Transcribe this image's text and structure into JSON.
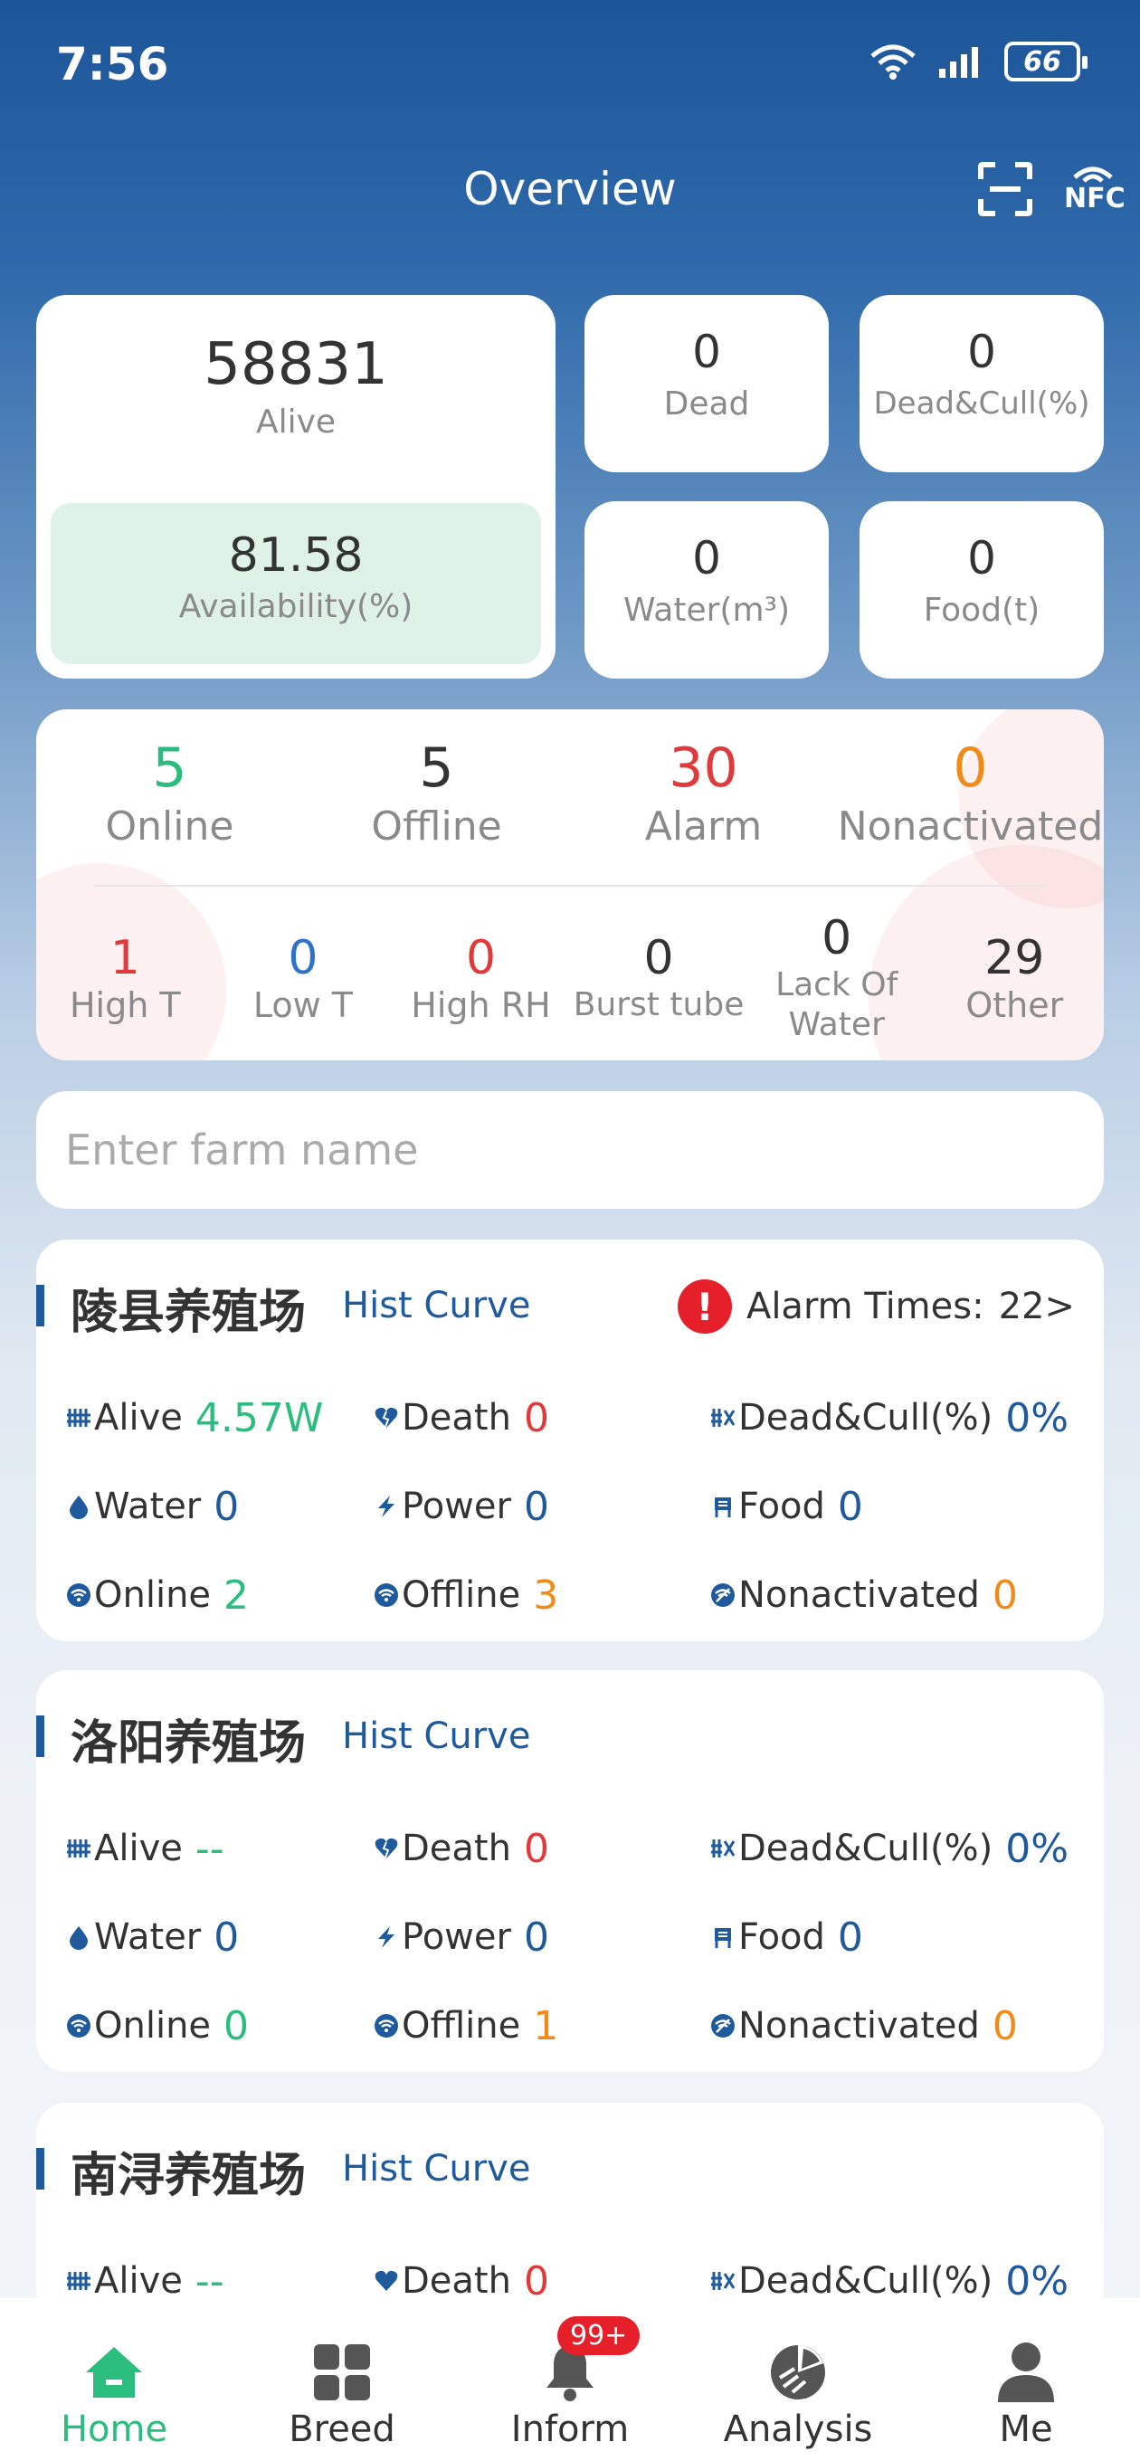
{
  "status_bar": {
    "time": "7:56",
    "battery": "66"
  },
  "header": {
    "title": "Overview",
    "nfc_label": "NFC"
  },
  "overview": {
    "alive": {
      "value": "58831",
      "label": "Alive"
    },
    "availability": {
      "value": "81.58",
      "label": "Availability(%)"
    },
    "dead": {
      "value": "0",
      "label": "Dead"
    },
    "dead_cull": {
      "value": "0",
      "label": "Dead&Cull(%)"
    },
    "water": {
      "value": "0",
      "label": "Water(m³)"
    },
    "food": {
      "value": "0",
      "label": "Food(t)"
    }
  },
  "devices": {
    "online": {
      "value": "5",
      "label": "Online"
    },
    "offline": {
      "value": "5",
      "label": "Offline"
    },
    "alarm": {
      "value": "30",
      "label": "Alarm"
    },
    "nonactivated": {
      "value": "0",
      "label": "Nonactivated"
    },
    "alarm_types": [
      {
        "value": "1",
        "label": "High T"
      },
      {
        "value": "0",
        "label": "Low T"
      },
      {
        "value": "0",
        "label": "High RH"
      },
      {
        "value": "0",
        "label": "Burst tube"
      },
      {
        "value": "0",
        "label": "Lack Of Water"
      },
      {
        "value": "29",
        "label": "Other"
      }
    ]
  },
  "search": {
    "placeholder": "Enter farm name"
  },
  "farms": [
    {
      "name": "陵县养殖场",
      "hist": "Hist Curve",
      "alarm_label": "Alarm Times:",
      "alarm_value": "22>",
      "alive_label": "Alive",
      "alive": "4.57W",
      "death_label": "Death",
      "death": "0",
      "deadcull_label": "Dead&Cull(%)",
      "deadcull": "0%",
      "water_label": "Water",
      "water": "0",
      "power_label": "Power",
      "power": "0",
      "food_label": "Food",
      "food": "0",
      "online_label": "Online",
      "online": "2",
      "offline_label": "Offline",
      "offline": "3",
      "nonact_label": "Nonactivated",
      "nonact": "0"
    },
    {
      "name": "洛阳养殖场",
      "hist": "Hist Curve",
      "alive_label": "Alive",
      "alive": "--",
      "death_label": "Death",
      "death": "0",
      "deadcull_label": "Dead&Cull(%)",
      "deadcull": "0%",
      "water_label": "Water",
      "water": "0",
      "power_label": "Power",
      "power": "0",
      "food_label": "Food",
      "food": "0",
      "online_label": "Online",
      "online": "0",
      "offline_label": "Offline",
      "offline": "1",
      "nonact_label": "Nonactivated",
      "nonact": "0"
    },
    {
      "name": "南浔养殖场",
      "hist": "Hist Curve",
      "alive_label": "Alive",
      "alive": "--",
      "death_label": "Death",
      "death": "0",
      "deadcull_label": "Dead&Cull(%)",
      "deadcull": "0%"
    }
  ],
  "nav": {
    "home": "Home",
    "breed": "Breed",
    "inform": "Inform",
    "inform_badge": "99+",
    "analysis": "Analysis",
    "me": "Me"
  },
  "colors": {
    "accent_green": "#2bbd7e",
    "brand_blue": "#1f5a9c",
    "alarm_red": "#e03a3a",
    "warn_orange": "#f08b1a"
  }
}
